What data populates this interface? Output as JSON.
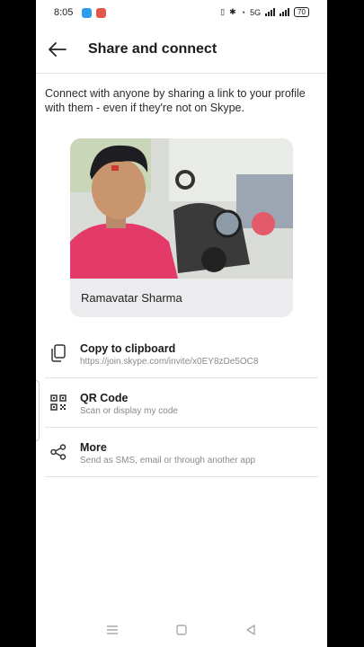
{
  "status": {
    "time": "8:05",
    "battery": "70",
    "network": "5G"
  },
  "header": {
    "title": "Share and connect",
    "back_icon": "arrow-left-icon"
  },
  "intro": "Connect with anyone by sharing a link to your profile with them - even if they're not on Skype.",
  "profile": {
    "name": "Ramavatar Sharma"
  },
  "options": [
    {
      "icon": "copy-icon",
      "title": "Copy to clipboard",
      "subtitle": "https://join.skype.com/invite/x0EY8zDe5OC8"
    },
    {
      "icon": "qr-code-icon",
      "title": "QR Code",
      "subtitle": "Scan or display my code"
    },
    {
      "icon": "share-icon",
      "title": "More",
      "subtitle": "Send as SMS, email or through another app"
    }
  ],
  "colors": {
    "background": "#ffffff",
    "card": "#ececee",
    "text": "#1b1b1b",
    "subtext": "#8a8a8a"
  }
}
